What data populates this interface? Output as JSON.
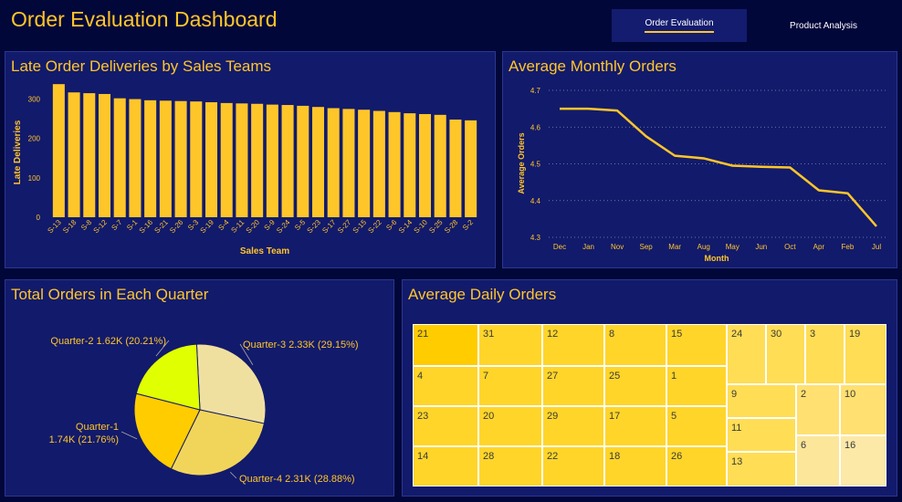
{
  "page": {
    "title": "Order Evaluation Dashboard"
  },
  "nav": {
    "order_eval": "Order Evaluation",
    "product_analysis": "Product Analysis"
  },
  "colors": {
    "background": "#02073a",
    "panel": "#121a6b",
    "accent": "#ffc62a"
  },
  "chart_data": [
    {
      "type": "bar",
      "title": "Late Order Deliveries by Sales Teams",
      "xlabel": "Sales Team",
      "ylabel": "Late Deliveries",
      "ylim": [
        0,
        350
      ],
      "yticks": [
        0,
        100,
        200,
        300
      ],
      "categories": [
        "S-13",
        "S-18",
        "S-8",
        "S-12",
        "S-7",
        "S-1",
        "S-16",
        "S-21",
        "S-26",
        "S-3",
        "S-19",
        "S-4",
        "S-11",
        "S-20",
        "S-9",
        "S-24",
        "S-5",
        "S-23",
        "S-17",
        "S-27",
        "S-15",
        "S-22",
        "S-6",
        "S-14",
        "S-10",
        "S-25",
        "S-28",
        "S-2"
      ],
      "values": [
        338,
        317,
        315,
        313,
        302,
        300,
        297,
        296,
        295,
        294,
        292,
        290,
        289,
        288,
        286,
        285,
        283,
        280,
        277,
        275,
        273,
        270,
        267,
        264,
        262,
        260,
        248,
        246
      ]
    },
    {
      "type": "line",
      "title": "Average Monthly Orders",
      "xlabel": "Month",
      "ylabel": "Average Orders",
      "ylim": [
        4.3,
        4.7
      ],
      "yticks": [
        "4.3",
        "4.4",
        "4.5",
        "4.6",
        "4.7"
      ],
      "grid": true,
      "categories": [
        "Dec",
        "Jan",
        "Nov",
        "Sep",
        "Mar",
        "Aug",
        "May",
        "Jun",
        "Oct",
        "Apr",
        "Feb",
        "Jul"
      ],
      "values": [
        4.65,
        4.65,
        4.645,
        4.575,
        4.522,
        4.515,
        4.495,
        4.492,
        4.49,
        4.428,
        4.42,
        4.33
      ]
    },
    {
      "type": "pie",
      "title": "Total Orders in Each Quarter",
      "slices": [
        {
          "name": "Quarter-3",
          "value": 2330,
          "percent": 29.15,
          "label": "Quarter-3 2.33K (29.15%)",
          "color": "#f0e0a0"
        },
        {
          "name": "Quarter-4",
          "value": 2310,
          "percent": 28.88,
          "label": "Quarter-4 2.31K (28.88%)",
          "color": "#f1d55b"
        },
        {
          "name": "Quarter-1",
          "value": 1740,
          "percent": 21.76,
          "label_line1": "Quarter-1",
          "label_line2": "1.74K (21.76%)",
          "color": "#ffcc00"
        },
        {
          "name": "Quarter-2",
          "value": 1620,
          "percent": 20.21,
          "label": "Quarter-2 1.62K (20.21%)",
          "color": "#e0ff00"
        }
      ]
    },
    {
      "type": "heatmap",
      "title": "Average Daily Orders",
      "cells": [
        {
          "label": "21",
          "color": "#ffcc00"
        },
        {
          "label": "4",
          "color": "#ffd52a"
        },
        {
          "label": "23",
          "color": "#ffd52a"
        },
        {
          "label": "14",
          "color": "#ffd52a"
        },
        {
          "label": "31",
          "color": "#ffd52a"
        },
        {
          "label": "7",
          "color": "#ffd52a"
        },
        {
          "label": "20",
          "color": "#ffd52a"
        },
        {
          "label": "28",
          "color": "#ffd52a"
        },
        {
          "label": "12",
          "color": "#ffd52a"
        },
        {
          "label": "27",
          "color": "#ffd52a"
        },
        {
          "label": "29",
          "color": "#ffd52a"
        },
        {
          "label": "22",
          "color": "#ffd52a"
        },
        {
          "label": "8",
          "color": "#ffd52a"
        },
        {
          "label": "25",
          "color": "#ffd52a"
        },
        {
          "label": "17",
          "color": "#ffd52a"
        },
        {
          "label": "18",
          "color": "#ffd52a"
        },
        {
          "label": "15",
          "color": "#ffd52a"
        },
        {
          "label": "1",
          "color": "#ffd52a"
        },
        {
          "label": "5",
          "color": "#ffd52a"
        },
        {
          "label": "26",
          "color": "#ffd52a"
        },
        {
          "label": "24",
          "color": "#ffdd55"
        },
        {
          "label": "30",
          "color": "#ffdd55"
        },
        {
          "label": "3",
          "color": "#ffdd55"
        },
        {
          "label": "19",
          "color": "#ffdd55"
        },
        {
          "label": "9",
          "color": "#ffdd55"
        },
        {
          "label": "11",
          "color": "#ffdd55"
        },
        {
          "label": "13",
          "color": "#ffdd55"
        },
        {
          "label": "2",
          "color": "#ffe070"
        },
        {
          "label": "10",
          "color": "#ffe070"
        },
        {
          "label": "6",
          "color": "#fbe69a"
        },
        {
          "label": "16",
          "color": "#fce9a8"
        }
      ]
    }
  ]
}
